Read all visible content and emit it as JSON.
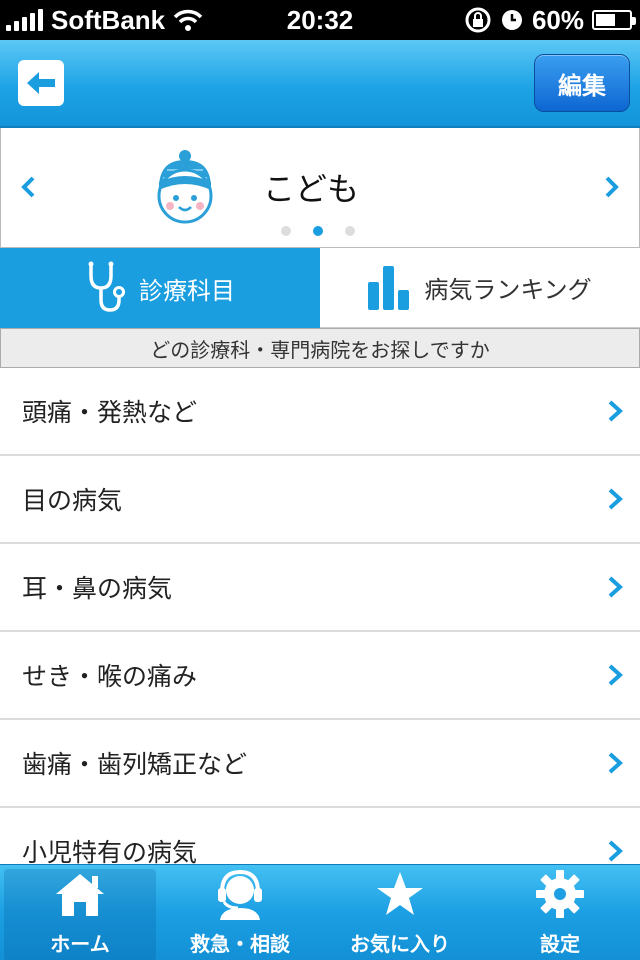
{
  "status_bar": {
    "carrier": "SoftBank",
    "time": "20:32",
    "battery": "60%",
    "battery_level": 0.6
  },
  "nav_bar": {
    "back_icon": "back-arrow-icon",
    "edit_label": "編集"
  },
  "profile": {
    "name": "こども",
    "avatar_icon": "child-avatar-icon",
    "page_count": 3,
    "active_page": 2
  },
  "tabs": [
    {
      "label": "診療科目",
      "icon": "stethoscope-icon",
      "active": true
    },
    {
      "label": "病気ランキング",
      "icon": "bar-chart-icon",
      "active": false
    }
  ],
  "prompt": "どの診療科・専門病院をお探しですか",
  "list": [
    {
      "label": "頭痛・発熱など"
    },
    {
      "label": "目の病気"
    },
    {
      "label": "耳・鼻の病気"
    },
    {
      "label": "せき・喉の痛み"
    },
    {
      "label": "歯痛・歯列矯正など"
    },
    {
      "label": "小児特有の病気"
    }
  ],
  "tab_bar": [
    {
      "label": "ホーム",
      "icon": "home-icon",
      "selected": true
    },
    {
      "label": "救急・相談",
      "icon": "headset-icon",
      "selected": false
    },
    {
      "label": "お気に入り",
      "icon": "star-icon",
      "selected": false
    },
    {
      "label": "設定",
      "icon": "gear-icon",
      "selected": false
    }
  ],
  "colors": {
    "accent": "#1a9ee0",
    "nav_bar": "#1ea3e6",
    "edit_button": "#0e66d2"
  }
}
